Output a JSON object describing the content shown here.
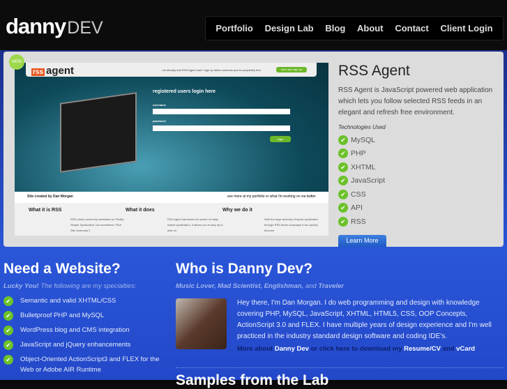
{
  "header": {
    "logo_main": "danny",
    "logo_sub": "DEV",
    "nav": [
      "Portfolio",
      "Design Lab",
      "Blog",
      "About",
      "Contact",
      "Client Login"
    ]
  },
  "featured": {
    "badge": "NEW",
    "preview": {
      "logo_box": "rss",
      "logo_text": "agent",
      "signup_text": "not already and RSS Agent user? sign up takes moments and is completely free",
      "signup_btn": "new user sign up",
      "login_title": "registered users login here",
      "username": "username",
      "password": "password",
      "login_btn": "login",
      "credit": "Site created by Dan Morgan",
      "credit_right": "see more at my portfolio or what i'm working on via twitter",
      "cols": [
        {
          "title": "What it is RSS",
          "text": "RSS (most commonly translated as \"Really Simple Syndication\" but sometimes \"Rich Site Summary\")"
        },
        {
          "title": "What it does",
          "text": "RSS Agent harnesses the power of really simple syndication, it allows you to stay up to date on"
        },
        {
          "title": "Why we do it",
          "text": "With the huge diversity of topics syndicated through RSS feeds nowadays it can quickly become"
        }
      ]
    },
    "title": "RSS Agent",
    "description": "RSS Agent is JavaScript powered web application which lets you follow selected RSS feeds in an elegant and refresh free environment.",
    "tech_label": "Technologies Used",
    "technologies": [
      "MySQL",
      "PHP",
      "XHTML",
      "JavaScript",
      "CSS",
      "API",
      "RSS"
    ],
    "learn_more": "Learn More"
  },
  "need": {
    "title": "Need a Website?",
    "sub_bold": "Lucky You!",
    "sub_rest": " The following are my specialties:",
    "items": [
      "Semantic and valid XHTML/CSS",
      "Bulletproof PHP and MySQL",
      "WordPress blog and CMS integration",
      "JavaScript and jQuery enhancements",
      "Object-Oriented ActionScript3 and FLEX for the Web or Adobe AIR Runtime"
    ]
  },
  "who": {
    "title": "Who is Danny Dev?",
    "sub_bold": "Music Lover, Mad Scientist, Englishman,",
    "sub_and": " and ",
    "sub_last": "Traveler",
    "bio": "Hey there, I'm Dan Morgan. I do web programming and design with knowledge covering PHP, MySQL, JavaScript, XHTML, HTML5, CSS, OOP Concepts, ActionScript 3.0 and FLEX. I have multiple years of design experience and I'm well practiced in the industry standard design software and coding IDE's.",
    "more_prefix": "More about ",
    "more_link1": "Danny Dev",
    "more_mid": " or click here to download my ",
    "more_link2": "Resume/CV",
    "more_and": " and ",
    "more_link3": "vCard"
  },
  "lab": {
    "title": "Samples from the Lab"
  }
}
